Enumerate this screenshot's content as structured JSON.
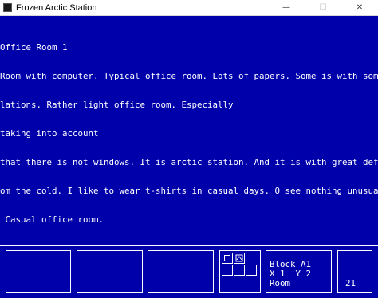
{
  "window": {
    "title": "Frozen Arctic Station",
    "minimize_glyph": "—",
    "maximize_glyph": "☐",
    "close_glyph": "✕"
  },
  "room_text": {
    "lines": [
      "Office Room 1",
      "Room with computer. Typical office room. Lots of papers. Some is with some calcu",
      "lations. Rather light office room. Especially",
      "taking into account",
      "that there is not windows. It is arctic station. And it is with great defense fr",
      "om the cold. I like to wear t-shirts in casual days. O see nothing unusual here.",
      " Casual office room."
    ]
  },
  "status": {
    "block": "Block A1",
    "coords": "X 1  Y 2",
    "location_type": "Room",
    "counter": "21"
  },
  "colors": {
    "background": "#0000aa",
    "foreground": "#ffffff"
  }
}
